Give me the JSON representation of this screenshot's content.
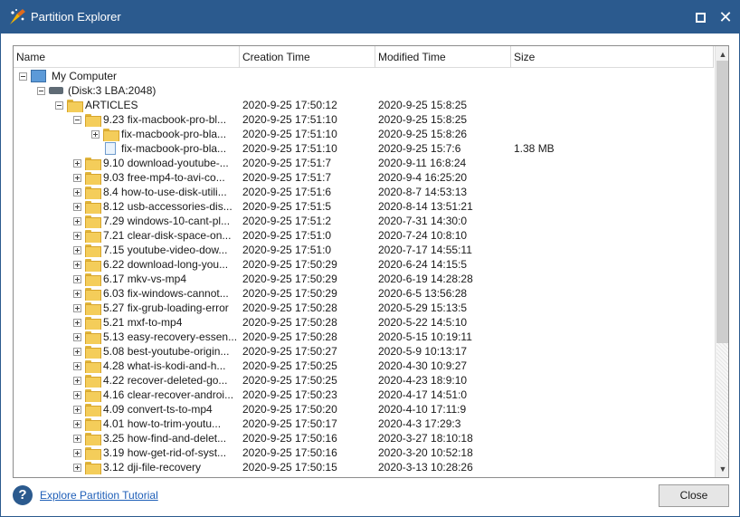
{
  "window": {
    "title": "Partition Explorer",
    "maximize_icon": "maximize-icon",
    "close_icon": "close-icon",
    "accent_color": "#2b5a8e"
  },
  "columns": {
    "name": "Name",
    "creation": "Creation Time",
    "modified": "Modified Time",
    "size": "Size"
  },
  "rows": [
    {
      "name": "My Computer",
      "creation": "",
      "modified": "",
      "size": "",
      "level": 0,
      "exp": "minus",
      "icon": "computer"
    },
    {
      "name": "(Disk:3 LBA:2048)",
      "creation": "",
      "modified": "",
      "size": "",
      "level": 1,
      "exp": "minus",
      "icon": "disk"
    },
    {
      "name": "ARTICLES",
      "creation": "2020-9-25 17:50:12",
      "modified": "2020-9-25 15:8:25",
      "size": "",
      "level": 2,
      "exp": "minus",
      "icon": "folder"
    },
    {
      "name": "9.23 fix-macbook-pro-bl...",
      "creation": "2020-9-25 17:51:10",
      "modified": "2020-9-25 15:8:25",
      "size": "",
      "level": 3,
      "exp": "minus",
      "icon": "folder"
    },
    {
      "name": "fix-macbook-pro-bla...",
      "creation": "2020-9-25 17:51:10",
      "modified": "2020-9-25 15:8:26",
      "size": "",
      "level": 4,
      "exp": "plus",
      "icon": "folder"
    },
    {
      "name": "fix-macbook-pro-bla...",
      "creation": "2020-9-25 17:51:10",
      "modified": "2020-9-25 15:7:6",
      "size": "1.38 MB",
      "level": 4,
      "exp": "none",
      "icon": "file"
    },
    {
      "name": "9.10 download-youtube-...",
      "creation": "2020-9-25 17:51:7",
      "modified": "2020-9-11 16:8:24",
      "size": "",
      "level": 3,
      "exp": "plus",
      "icon": "folder"
    },
    {
      "name": "9.03 free-mp4-to-avi-co...",
      "creation": "2020-9-25 17:51:7",
      "modified": "2020-9-4 16:25:20",
      "size": "",
      "level": 3,
      "exp": "plus",
      "icon": "folder"
    },
    {
      "name": "8.4 how-to-use-disk-utili...",
      "creation": "2020-9-25 17:51:6",
      "modified": "2020-8-7 14:53:13",
      "size": "",
      "level": 3,
      "exp": "plus",
      "icon": "folder"
    },
    {
      "name": "8.12 usb-accessories-dis...",
      "creation": "2020-9-25 17:51:5",
      "modified": "2020-8-14 13:51:21",
      "size": "",
      "level": 3,
      "exp": "plus",
      "icon": "folder"
    },
    {
      "name": "7.29 windows-10-cant-pl...",
      "creation": "2020-9-25 17:51:2",
      "modified": "2020-7-31 14:30:0",
      "size": "",
      "level": 3,
      "exp": "plus",
      "icon": "folder"
    },
    {
      "name": "7.21 clear-disk-space-on...",
      "creation": "2020-9-25 17:51:0",
      "modified": "2020-7-24 10:8:10",
      "size": "",
      "level": 3,
      "exp": "plus",
      "icon": "folder"
    },
    {
      "name": "7.15 youtube-video-dow...",
      "creation": "2020-9-25 17:51:0",
      "modified": "2020-7-17 14:55:11",
      "size": "",
      "level": 3,
      "exp": "plus",
      "icon": "folder"
    },
    {
      "name": "6.22 download-long-you...",
      "creation": "2020-9-25 17:50:29",
      "modified": "2020-6-24 14:15:5",
      "size": "",
      "level": 3,
      "exp": "plus",
      "icon": "folder"
    },
    {
      "name": "6.17 mkv-vs-mp4",
      "creation": "2020-9-25 17:50:29",
      "modified": "2020-6-19 14:28:28",
      "size": "",
      "level": 3,
      "exp": "plus",
      "icon": "folder"
    },
    {
      "name": "6.03 fix-windows-cannot...",
      "creation": "2020-9-25 17:50:29",
      "modified": "2020-6-5 13:56:28",
      "size": "",
      "level": 3,
      "exp": "plus",
      "icon": "folder"
    },
    {
      "name": "5.27 fix-grub-loading-error",
      "creation": "2020-9-25 17:50:28",
      "modified": "2020-5-29 15:13:5",
      "size": "",
      "level": 3,
      "exp": "plus",
      "icon": "folder"
    },
    {
      "name": "5.21 mxf-to-mp4",
      "creation": "2020-9-25 17:50:28",
      "modified": "2020-5-22 14:5:10",
      "size": "",
      "level": 3,
      "exp": "plus",
      "icon": "folder"
    },
    {
      "name": "5.13 easy-recovery-essen...",
      "creation": "2020-9-25 17:50:28",
      "modified": "2020-5-15 10:19:11",
      "size": "",
      "level": 3,
      "exp": "plus",
      "icon": "folder"
    },
    {
      "name": "5.08 best-youtube-origin...",
      "creation": "2020-9-25 17:50:27",
      "modified": "2020-5-9 10:13:17",
      "size": "",
      "level": 3,
      "exp": "plus",
      "icon": "folder"
    },
    {
      "name": "4.28 what-is-kodi-and-h...",
      "creation": "2020-9-25 17:50:25",
      "modified": "2020-4-30 10:9:27",
      "size": "",
      "level": 3,
      "exp": "plus",
      "icon": "folder"
    },
    {
      "name": "4.22 recover-deleted-go...",
      "creation": "2020-9-25 17:50:25",
      "modified": "2020-4-23 18:9:10",
      "size": "",
      "level": 3,
      "exp": "plus",
      "icon": "folder"
    },
    {
      "name": "4.16 clear-recover-androi...",
      "creation": "2020-9-25 17:50:23",
      "modified": "2020-4-17 14:51:0",
      "size": "",
      "level": 3,
      "exp": "plus",
      "icon": "folder"
    },
    {
      "name": "4.09 convert-ts-to-mp4",
      "creation": "2020-9-25 17:50:20",
      "modified": "2020-4-10 17:11:9",
      "size": "",
      "level": 3,
      "exp": "plus",
      "icon": "folder"
    },
    {
      "name": "4.01 how-to-trim-youtu...",
      "creation": "2020-9-25 17:50:17",
      "modified": "2020-4-3 17:29:3",
      "size": "",
      "level": 3,
      "exp": "plus",
      "icon": "folder"
    },
    {
      "name": "3.25 how-find-and-delet...",
      "creation": "2020-9-25 17:50:16",
      "modified": "2020-3-27 18:10:18",
      "size": "",
      "level": 3,
      "exp": "plus",
      "icon": "folder"
    },
    {
      "name": "3.19 how-get-rid-of-syst...",
      "creation": "2020-9-25 17:50:16",
      "modified": "2020-3-20 10:52:18",
      "size": "",
      "level": 3,
      "exp": "plus",
      "icon": "folder"
    },
    {
      "name": "3.12 dji-file-recovery",
      "creation": "2020-9-25 17:50:15",
      "modified": "2020-3-13 10:28:26",
      "size": "",
      "level": 3,
      "exp": "plus",
      "icon": "folder"
    }
  ],
  "footer": {
    "help_icon_glyph": "?",
    "tutorial_link": "Explore Partition Tutorial",
    "close_button": "Close"
  }
}
